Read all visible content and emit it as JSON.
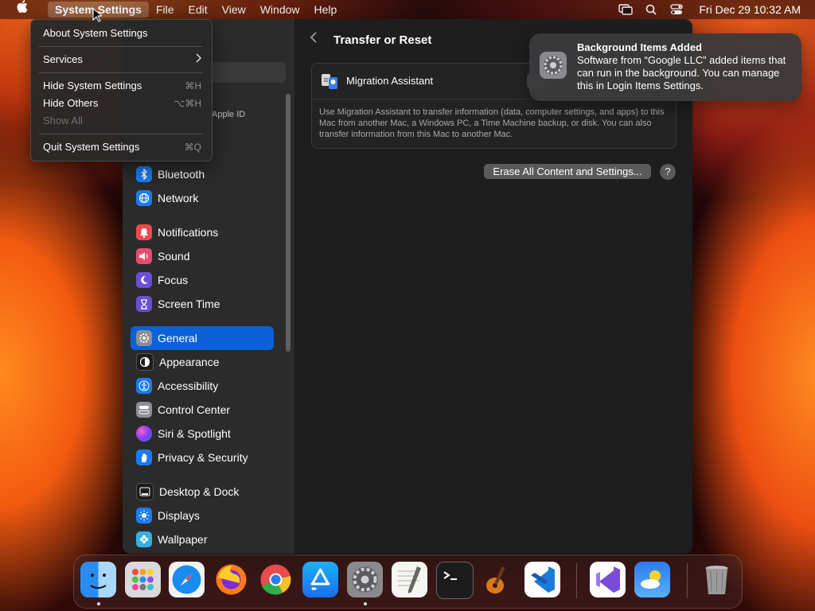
{
  "menubar": {
    "app_name": "System Settings",
    "items": [
      "File",
      "Edit",
      "View",
      "Window",
      "Help"
    ],
    "clock": "Fri Dec 29  10:32 AM"
  },
  "app_menu": {
    "about": "About System Settings",
    "services": "Services",
    "hide": "Hide System Settings",
    "hide_shortcut": "⌘H",
    "hide_others": "Hide Others",
    "hide_others_shortcut": "⌥⌘H",
    "show_all": "Show All",
    "quit": "Quit System Settings",
    "quit_shortcut": "⌘Q"
  },
  "sidebar": {
    "apple_id": "Apple ID",
    "items": [
      {
        "label": "Bluetooth",
        "icon": "bluetooth-icon",
        "color": "#1a7cf0"
      },
      {
        "label": "Network",
        "icon": "globe-icon",
        "color": "#1a7cf0"
      },
      {
        "label": "Notifications",
        "icon": "bell-icon",
        "color": "#eb4b4b"
      },
      {
        "label": "Sound",
        "icon": "speaker-icon",
        "color": "#eb4b6a"
      },
      {
        "label": "Focus",
        "icon": "moon-icon",
        "color": "#6a4fd8"
      },
      {
        "label": "Screen Time",
        "icon": "hourglass-icon",
        "color": "#6a4fd8"
      },
      {
        "label": "General",
        "icon": "gear-icon",
        "color": "#8e8e93"
      },
      {
        "label": "Appearance",
        "icon": "appearance-icon",
        "color": "#1c1c1c"
      },
      {
        "label": "Accessibility",
        "icon": "accessibility-icon",
        "color": "#1a7cf0"
      },
      {
        "label": "Control Center",
        "icon": "control-center-icon",
        "color": "#8e8e93"
      },
      {
        "label": "Siri & Spotlight",
        "icon": "siri-icon",
        "color": "#c43cc4"
      },
      {
        "label": "Privacy & Security",
        "icon": "hand-icon",
        "color": "#1a7cf0"
      },
      {
        "label": "Desktop & Dock",
        "icon": "dock-icon",
        "color": "#1c1c1c"
      },
      {
        "label": "Displays",
        "icon": "sun-icon",
        "color": "#1a7cf0"
      },
      {
        "label": "Wallpaper",
        "icon": "flower-icon",
        "color": "#35b0e0"
      }
    ]
  },
  "content": {
    "title": "Transfer or Reset",
    "migration_label": "Migration Assistant",
    "migration_desc": "Use Migration Assistant to transfer information (data, computer settings, and apps) to this Mac from another Mac, a Windows PC, a Time Machine backup, or disk. You can also transfer information from this Mac to another Mac.",
    "erase_button": "Erase All Content and Settings...",
    "help_button": "?"
  },
  "notification": {
    "title": "Background Items Added",
    "body": "Software from “Google LLC” added items that can run in the background. You can manage this in Login Items Settings."
  },
  "dock": {
    "apps": [
      "finder-icon",
      "launchpad-icon",
      "safari-icon",
      "firefox-icon",
      "chrome-icon",
      "app-store-icon",
      "system-settings-icon",
      "textedit-icon",
      "terminal-icon",
      "garageband-icon",
      "vscode-icon",
      "visual-studio-icon",
      "weather-icon",
      "trash-icon"
    ]
  }
}
